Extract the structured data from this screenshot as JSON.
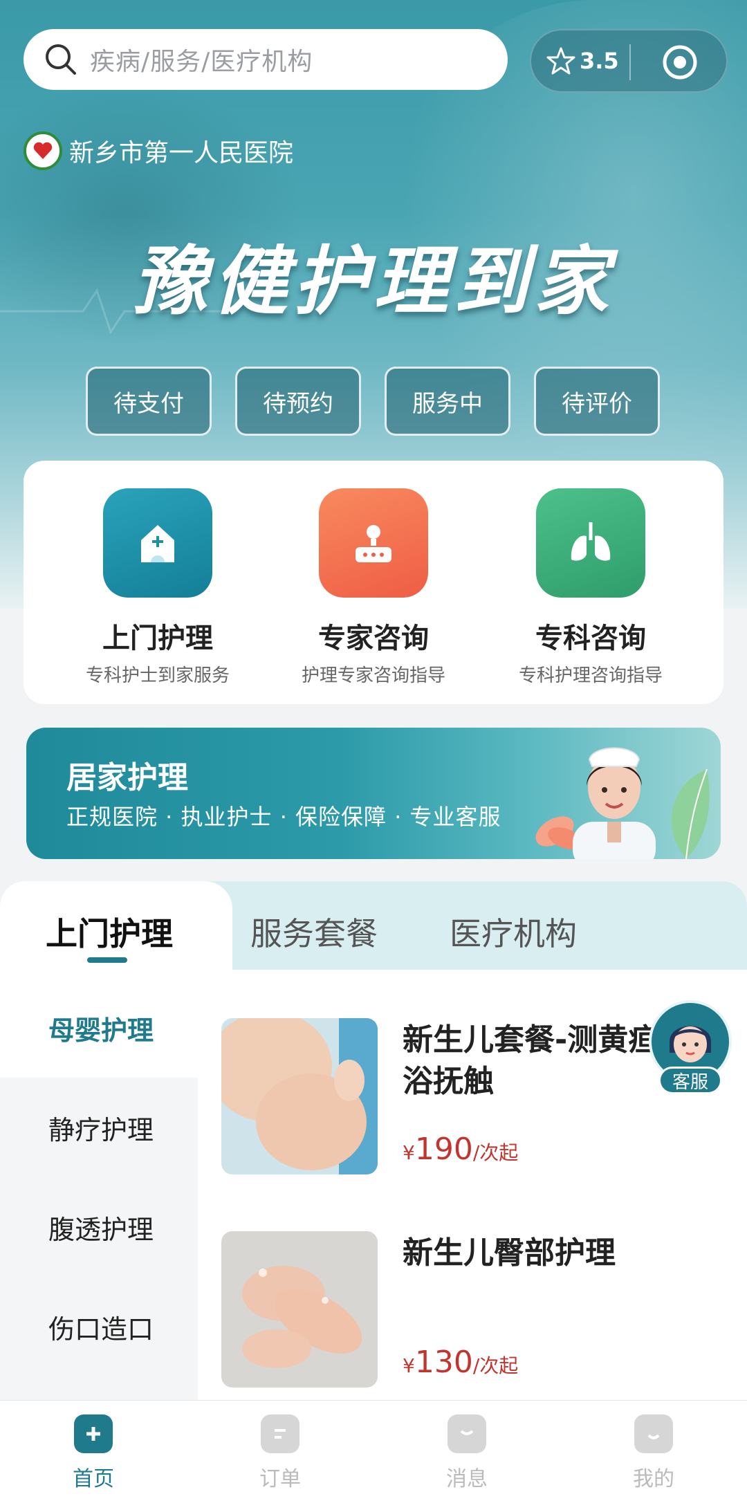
{
  "search": {
    "placeholder": "疾病/服务/医疗机构"
  },
  "header": {
    "rating": "3.5",
    "hospital_name": "新乡市第一人民医院",
    "slogan": "豫健护理到家"
  },
  "status_buttons": [
    "待支付",
    "待预约",
    "服务中",
    "待评价"
  ],
  "services": [
    {
      "title": "上门护理",
      "subtitle": "专科护士到家服务",
      "color": "#1e8fa6",
      "icon": "house-plus-icon"
    },
    {
      "title": "专家咨询",
      "subtitle": "护理专家咨询指导",
      "color": "#f26c4f",
      "icon": "doctor-desk-icon"
    },
    {
      "title": "专科咨询",
      "subtitle": "专科护理咨询指导",
      "color": "#3dae7a",
      "icon": "lungs-icon"
    }
  ],
  "banner": {
    "title": "居家护理",
    "subtitle": "正规医院 · 执业护士 · 保险保障 · 专业客服"
  },
  "tabs": [
    "上门护理",
    "服务套餐",
    "医疗机构"
  ],
  "categories": [
    "母婴护理",
    "静疗护理",
    "腹透护理",
    "伤口造口"
  ],
  "products": [
    {
      "title": "新生儿套餐-测黄疸沐浴抚触",
      "currency": "¥",
      "price": "190",
      "unit": "/次起"
    },
    {
      "title": "新生儿臀部护理",
      "currency": "¥",
      "price": "130",
      "unit": "/次起"
    }
  ],
  "customer_service": {
    "label": "客服"
  },
  "bottom_nav": [
    {
      "label": "首页",
      "active": true
    },
    {
      "label": "订单",
      "active": false
    },
    {
      "label": "消息",
      "active": false
    },
    {
      "label": "我的",
      "active": false
    }
  ],
  "colors": {
    "primary": "#1f7a8c",
    "price": "#c2352e"
  }
}
